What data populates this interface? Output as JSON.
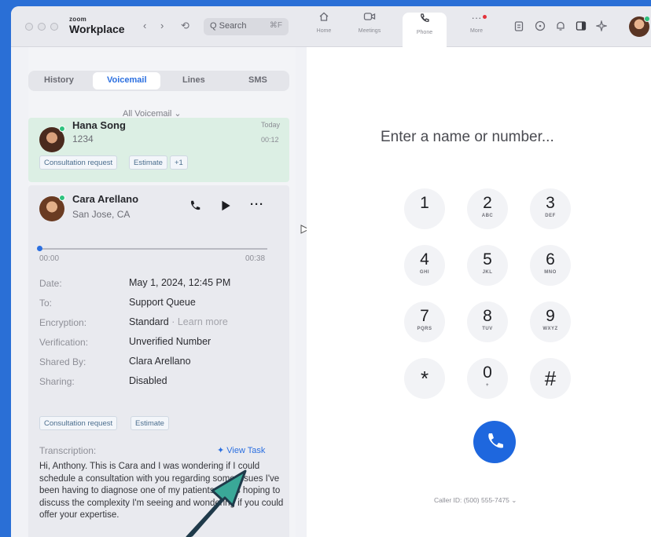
{
  "titlebar": {
    "brand_small": "zoom",
    "brand_big": "Workplace",
    "back": "‹",
    "forward": "›",
    "history": "⟲",
    "search_placeholder": "Q Search",
    "search_shortcut": "⌘F",
    "tabs": [
      {
        "label": "Home",
        "icon": "home-icon"
      },
      {
        "label": "Meetings",
        "icon": "video-icon"
      },
      {
        "label": "Phone",
        "icon": "phone-icon"
      },
      {
        "label": "More",
        "icon": "more-icon"
      }
    ]
  },
  "left": {
    "tabs": [
      "History",
      "Voicemail",
      "Lines",
      "SMS"
    ],
    "filter": "All Voicemail ⌄",
    "voicemail1": {
      "name": "Hana Song",
      "number": "1234",
      "date": "Today",
      "duration": "00:12",
      "chips": [
        "Consultation request",
        "Estimate",
        "+1"
      ]
    },
    "voicemail2": {
      "name": "Cara Arellano",
      "location": "San Jose, CA",
      "time_start": "00:00",
      "time_end": "00:38",
      "details": [
        {
          "label": "Date:",
          "value": "May 1, 2024, 12:45 PM"
        },
        {
          "label": "To:",
          "value": "Support Queue"
        },
        {
          "label": "Encryption:",
          "value": "Standard",
          "extra": " · Learn more"
        },
        {
          "label": "Verification:",
          "value": "Unverified Number"
        },
        {
          "label": "Shared By:",
          "value": "Clara Arellano"
        },
        {
          "label": "Sharing:",
          "value": "Disabled"
        }
      ],
      "chips": [
        "Consultation request",
        "Estimate"
      ],
      "transcription_label": "Transcription:",
      "view_task": "✦ View Task",
      "transcript": "Hi, Anthony. This is Cara and I was wondering if I could schedule a consultation with you regarding some issues I've been having to diagnose one of my patients. I was hoping to discuss the complexity I'm seeing and wondering if you could offer your expertise."
    }
  },
  "dialer": {
    "prompt": "Enter a name or number...",
    "keys": [
      {
        "d": "1",
        "l": ""
      },
      {
        "d": "2",
        "l": "ABC"
      },
      {
        "d": "3",
        "l": "DEF"
      },
      {
        "d": "4",
        "l": "GHI"
      },
      {
        "d": "5",
        "l": "JKL"
      },
      {
        "d": "6",
        "l": "MNO"
      },
      {
        "d": "7",
        "l": "PQRS"
      },
      {
        "d": "8",
        "l": "TUV"
      },
      {
        "d": "9",
        "l": "WXYZ"
      },
      {
        "d": "*",
        "l": ""
      },
      {
        "d": "0",
        "l": "+"
      },
      {
        "d": "#",
        "l": ""
      }
    ],
    "caller_id": "Caller ID: (500) 555-7475 ⌄"
  }
}
